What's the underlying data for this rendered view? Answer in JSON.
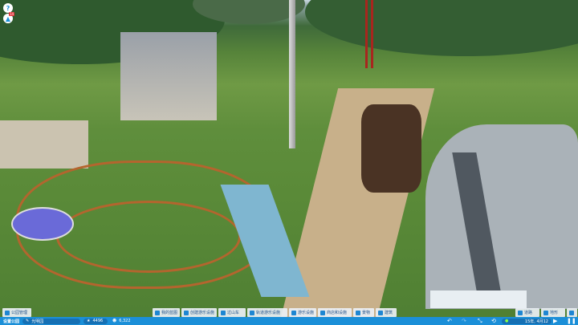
{
  "hud": {
    "help_icon": "?",
    "notification_badge": "14"
  },
  "toolbar": {
    "park_management": "公园管理",
    "blueprints": "我的蓝图",
    "create_rides": "创建游乐设施",
    "coasters": "过山车",
    "tracked_rides": "轨道游乐设施",
    "flat_rides": "游乐设施",
    "shops": "商店和设施",
    "scenery": "景物",
    "buildings": "建筑",
    "paths": "道路",
    "terrain": "地形"
  },
  "status": {
    "park_label": "设置公园",
    "park_name": "光明园",
    "rating": "4496",
    "guests": "6,322",
    "date": "15年, 4月12"
  },
  "colors": {
    "accent": "#1b8fd8"
  }
}
